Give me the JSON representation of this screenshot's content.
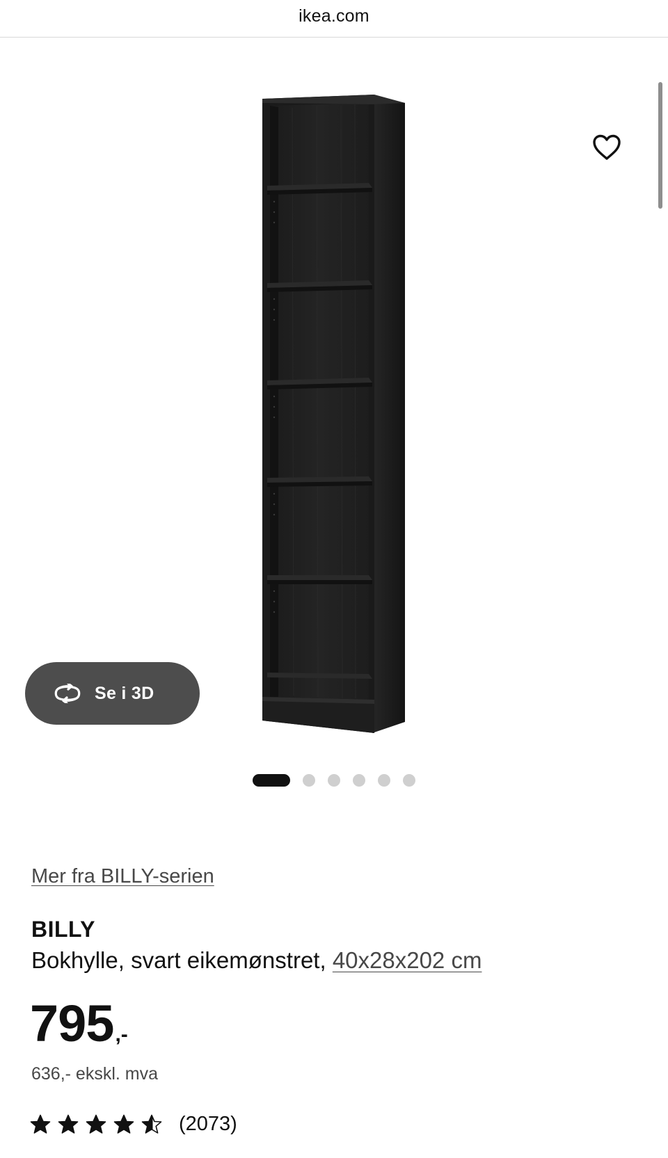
{
  "browser": {
    "url": "ikea.com"
  },
  "gallery": {
    "view3d_label": "Se i 3D",
    "image_count": 6,
    "active_index": 0
  },
  "product": {
    "series_link": "Mer fra BILLY-serien",
    "name": "BILLY",
    "description": "Bokhylle, svart eikemønstret, ",
    "dimensions": "40x28x202 cm",
    "price_main": "795",
    "price_suffix": ",-",
    "price_ex_vat": "636,- ekskl. mva",
    "rating_value": 4.7,
    "rating_max": 5,
    "rating_count": "(2073)"
  },
  "icons": {
    "favourite": "heart-outline-icon",
    "view3d": "rotate-3d-icon",
    "rating": "star-icon"
  },
  "colors": {
    "text": "#111111",
    "muted": "#484848",
    "button_3d": "#4d4d4d",
    "dot_inactive": "#cfcfcf",
    "product_wood": "#1c1c1c"
  }
}
